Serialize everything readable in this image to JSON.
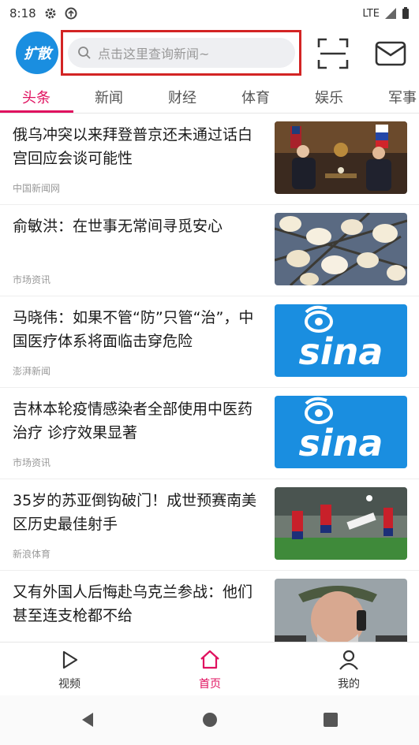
{
  "status_bar": {
    "time": "8:18",
    "network": "LTE"
  },
  "header": {
    "logo_text": "扩散",
    "search_placeholder": "点击这里查询新闻~",
    "icons": [
      "search-icon",
      "scan-icon",
      "mail-icon"
    ]
  },
  "tabs": [
    {
      "label": "头条",
      "active": true
    },
    {
      "label": "新闻"
    },
    {
      "label": "财经"
    },
    {
      "label": "体育"
    },
    {
      "label": "娱乐"
    },
    {
      "label": "军事"
    }
  ],
  "news": [
    {
      "title": "俄乌冲突以来拜登普京还未通过话白宫回应会谈可能性",
      "source": "中国新闻网",
      "thumb": "photo-leaders-meeting"
    },
    {
      "title": "俞敏洪：在世事无常间寻觅安心",
      "source": "市场资讯",
      "thumb": "photo-magnolia-flowers"
    },
    {
      "title": "马晓伟：如果不管“防”只管“治”，中国医疗体系将面临击穿危险",
      "source": "澎湃新闻",
      "thumb": "sina-logo"
    },
    {
      "title": "吉林本轮疫情感染者全部使用中医药治疗 诊疗效果显著",
      "source": "市场资讯",
      "thumb": "sina-logo"
    },
    {
      "title": "35岁的苏亚倒钩破门！成世预赛南美区历史最佳射手",
      "source": "新浪体育",
      "thumb": "photo-football-match"
    },
    {
      "title": "又有外国人后悔赴乌克兰参战：他们甚至连支枪都不给",
      "source": "",
      "thumb": "photo-man-on-phone"
    }
  ],
  "sina_logo_text": "sina",
  "bottom_nav": [
    {
      "label": "视频",
      "icon": "play-icon"
    },
    {
      "label": "首页",
      "icon": "home-icon",
      "active": true
    },
    {
      "label": "我的",
      "icon": "user-icon"
    }
  ],
  "colors": {
    "accent": "#e0115f",
    "logo": "#1a8ee0",
    "sina_blue": "#1a8ee0",
    "highlight_box": "#d32424"
  }
}
